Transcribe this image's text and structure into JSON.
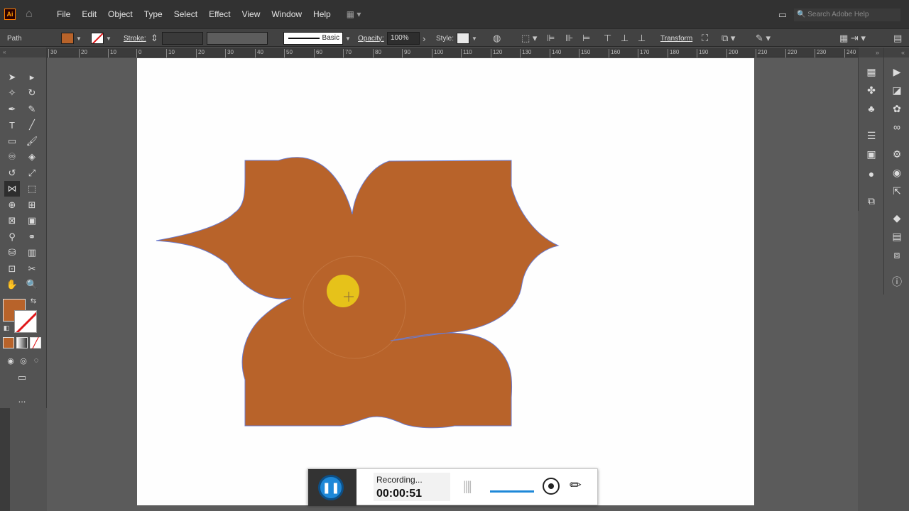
{
  "app": {
    "logo_text": "Ai",
    "menus": [
      "File",
      "Edit",
      "Object",
      "Type",
      "Select",
      "Effect",
      "View",
      "Window",
      "Help"
    ],
    "search_placeholder": "Search Adobe Help"
  },
  "control_bar": {
    "selection_type": "Path",
    "fill_color": "#b8632a",
    "stroke_label": "Stroke:",
    "stroke_profile": "Basic",
    "opacity_label": "Opacity:",
    "opacity_value": "100%",
    "style_label": "Style:",
    "transform_label": "Transform"
  },
  "ruler": {
    "ticks": [
      "30",
      "20",
      "10",
      "0",
      "10",
      "20",
      "30",
      "40",
      "50",
      "60",
      "70",
      "80",
      "90",
      "100",
      "110",
      "120",
      "130",
      "140",
      "150",
      "160",
      "170",
      "180",
      "190",
      "200",
      "210",
      "220",
      "230",
      "240"
    ]
  },
  "artwork": {
    "shape_fill": "#b8632a",
    "shape_stroke": "#6a7bd0",
    "cursor_highlight": "#e6c21a"
  },
  "recorder": {
    "status": "Recording...",
    "elapsed": "00:00:51",
    "accent": "#1e88d8"
  },
  "toolbar": {
    "more_label": "..."
  }
}
